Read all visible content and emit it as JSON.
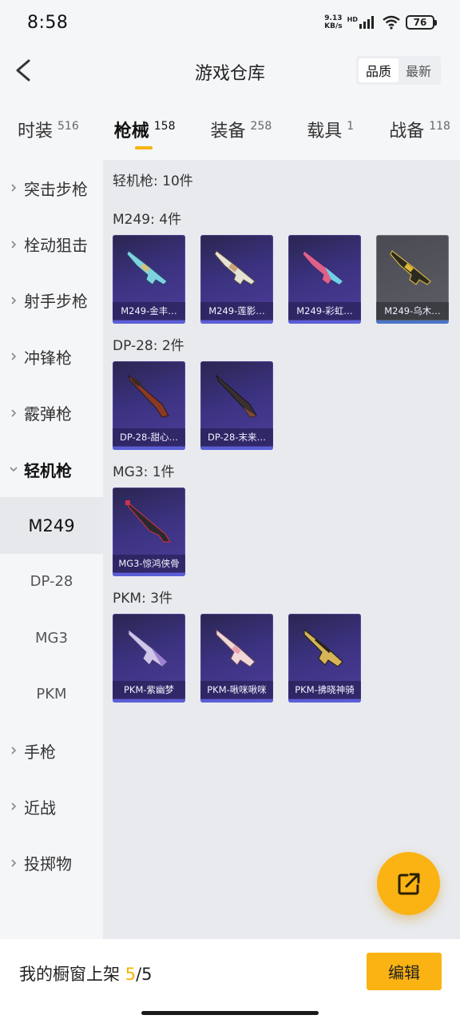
{
  "status": {
    "time": "8:58",
    "net_speed_value": "9.13",
    "net_speed_unit": "KB/s",
    "hd": "HD",
    "battery": "76"
  },
  "header": {
    "title": "游戏仓库",
    "sort_options": [
      "品质",
      "最新"
    ]
  },
  "category_tabs": [
    {
      "name": "时装",
      "count": "516"
    },
    {
      "name": "枪械",
      "count": "158"
    },
    {
      "name": "装备",
      "count": "258"
    },
    {
      "name": "载具",
      "count": "1"
    },
    {
      "name": "战备",
      "count": "118"
    }
  ],
  "sidebar": {
    "items": [
      {
        "label": "突击步枪"
      },
      {
        "label": "栓动狙击"
      },
      {
        "label": "射手步枪"
      },
      {
        "label": "冲锋枪"
      },
      {
        "label": "霰弹枪"
      },
      {
        "label": "轻机枪"
      }
    ],
    "sub_items": [
      "M249",
      "DP-28",
      "MG3",
      "PKM"
    ],
    "more_items": [
      {
        "label": "手枪"
      },
      {
        "label": "近战"
      },
      {
        "label": "投掷物"
      }
    ]
  },
  "content": {
    "summary": "轻机枪: 10件",
    "groups": [
      {
        "title": "M249: 4件",
        "items": [
          "M249-金丰…",
          "M249-莲影…",
          "M249-彩虹…",
          "M249-乌木…"
        ]
      },
      {
        "title": "DP-28: 2件",
        "items": [
          "DP-28-甜心…",
          "DP-28-末来…"
        ]
      },
      {
        "title": "MG3: 1件",
        "items": [
          "MG3-惊鸿侠骨"
        ]
      },
      {
        "title": "PKM: 3件",
        "items": [
          "PKM-紫幽梦",
          "PKM-啾咪啾咪",
          "PKM-拂晓神骑"
        ]
      }
    ]
  },
  "bottom": {
    "showcase_label": "我的橱窗上架 ",
    "showcase_current": "5",
    "showcase_total": "/5",
    "edit_label": "编辑"
  }
}
